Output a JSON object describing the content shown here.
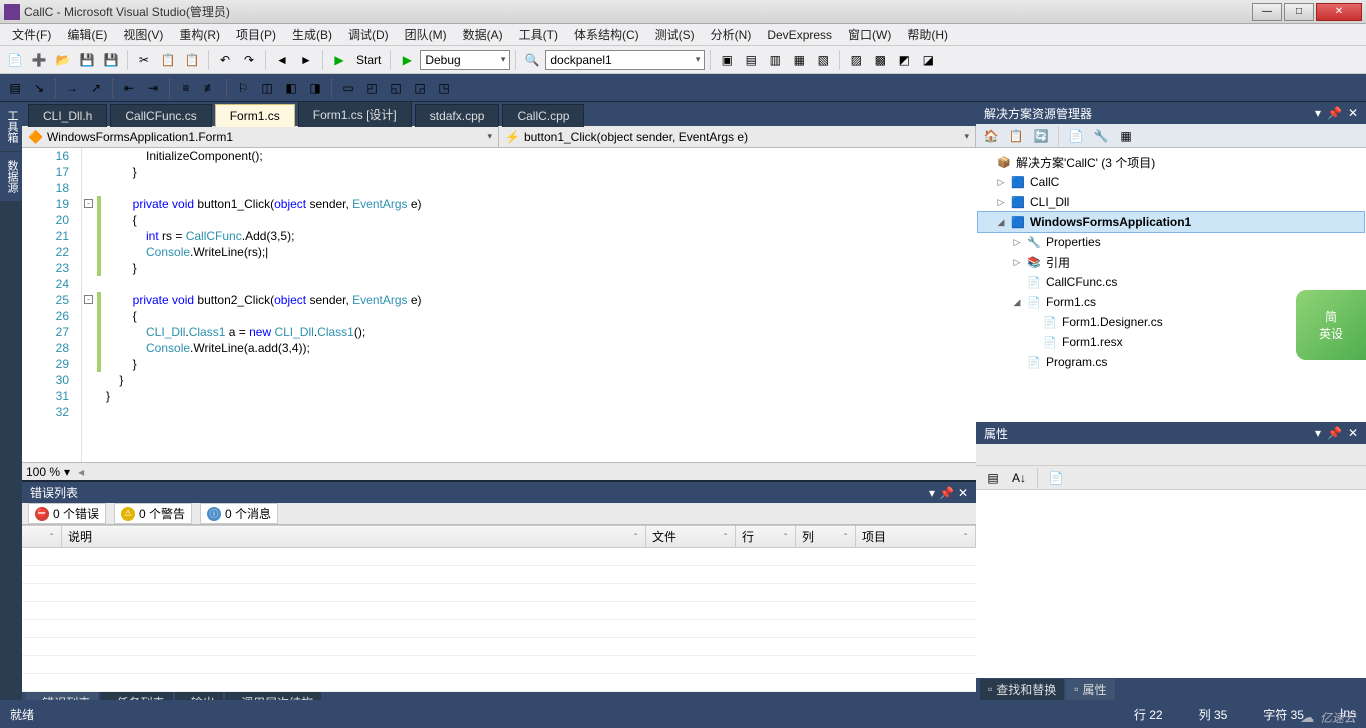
{
  "title": "CallC - Microsoft Visual Studio(管理员)",
  "menu": [
    "文件(F)",
    "编辑(E)",
    "视图(V)",
    "重构(R)",
    "项目(P)",
    "生成(B)",
    "调试(D)",
    "团队(M)",
    "数据(A)",
    "工具(T)",
    "体系结构(C)",
    "测试(S)",
    "分析(N)",
    "DevExpress",
    "窗口(W)",
    "帮助(H)"
  ],
  "toolbar1": {
    "start": "Start",
    "config": "Debug",
    "panel": "dockpanel1"
  },
  "leftTabs": [
    "工具箱",
    "数据源"
  ],
  "tabs": [
    {
      "label": "CLI_Dll.h",
      "active": false
    },
    {
      "label": "CallCFunc.cs",
      "active": false
    },
    {
      "label": "Form1.cs",
      "active": true
    },
    {
      "label": "Form1.cs [设计]",
      "active": false
    },
    {
      "label": "stdafx.cpp",
      "active": false
    },
    {
      "label": "CallC.cpp",
      "active": false
    }
  ],
  "nav": {
    "left": "WindowsFormsApplication1.Form1",
    "right": "button1_Click(object sender, EventArgs e)"
  },
  "code": {
    "start": 16,
    "lines": [
      "            InitializeComponent();",
      "        }",
      "",
      "        private void button1_Click(object sender, EventArgs e)",
      "        {",
      "            int rs = CallCFunc.Add(3,5);",
      "            Console.WriteLine(rs);|",
      "        }",
      "",
      "        private void button2_Click(object sender, EventArgs e)",
      "        {",
      "            CLI_Dll.Class1 a = new CLI_Dll.Class1();",
      "            Console.WriteLine(a.add(3,4));",
      "        }",
      "    }",
      "}",
      ""
    ]
  },
  "zoom": "100 %",
  "errorPanel": {
    "title": "错误列表",
    "badges": [
      {
        "icon": "⛔",
        "color": "#d04038",
        "text": "0 个错误"
      },
      {
        "icon": "⚠",
        "color": "#e2b300",
        "text": "0 个警告"
      },
      {
        "icon": "ⓘ",
        "color": "#4b8ec9",
        "text": "0 个消息"
      }
    ],
    "cols": [
      "",
      "说明",
      "文件",
      "行",
      "列",
      "项目"
    ],
    "bottomTabs": [
      "错误列表",
      "任务列表",
      "输出",
      "调用层次结构"
    ]
  },
  "solution": {
    "title": "解决方案资源管理器",
    "root": "解决方案'CallC' (3 个项目)",
    "items": [
      {
        "d": 1,
        "exp": "▷",
        "icon": "cs",
        "label": "CallC"
      },
      {
        "d": 1,
        "exp": "▷",
        "icon": "cs",
        "label": "CLI_Dll"
      },
      {
        "d": 1,
        "exp": "◢",
        "icon": "cs",
        "label": "WindowsFormsApplication1",
        "sel": true
      },
      {
        "d": 2,
        "exp": "▷",
        "icon": "prop",
        "label": "Properties"
      },
      {
        "d": 2,
        "exp": "▷",
        "icon": "ref",
        "label": "引用"
      },
      {
        "d": 2,
        "exp": "",
        "icon": "file",
        "label": "CallCFunc.cs"
      },
      {
        "d": 2,
        "exp": "◢",
        "icon": "file",
        "label": "Form1.cs"
      },
      {
        "d": 3,
        "exp": "",
        "icon": "file",
        "label": "Form1.Designer.cs"
      },
      {
        "d": 3,
        "exp": "",
        "icon": "file",
        "label": "Form1.resx"
      },
      {
        "d": 2,
        "exp": "",
        "icon": "file",
        "label": "Program.cs"
      }
    ]
  },
  "properties": {
    "title": "属性"
  },
  "rightBottomTabs": [
    "查找和替换",
    "属性"
  ],
  "status": {
    "ready": "就绪",
    "line": "行 22",
    "col": "列 35",
    "ch": "字符 35",
    "ins": "Ins"
  },
  "watermark": "亿速云",
  "sideBadge": "简\n英设"
}
